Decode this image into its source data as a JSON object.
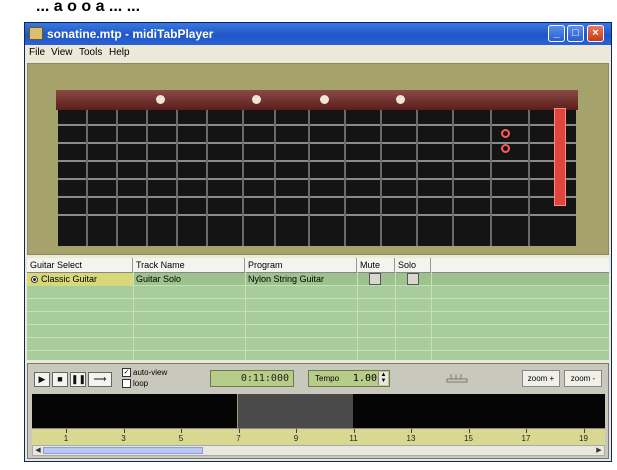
{
  "page_heading": "... a   o     o  a   ...    ...",
  "window": {
    "title": "sonatine.mtp - midiTabPlayer",
    "minimize_glyph": "_",
    "maximize_glyph": "□",
    "close_glyph": "×"
  },
  "menu": [
    "File",
    "View",
    "Tools",
    "Help"
  ],
  "fretboard": {
    "inlay_frets": [
      3,
      5,
      7,
      9
    ],
    "capo_color": "#e0443a"
  },
  "tracks": {
    "headers": [
      "Guitar Select",
      "Track Name",
      "Program",
      "Mute",
      "Solo"
    ],
    "rows": [
      {
        "guitar": "Classic Guitar",
        "name": "Guitar Solo",
        "program": "Nylon String Guitar",
        "selected": true
      }
    ]
  },
  "transport": {
    "buttons": {
      "play": "▶",
      "stop": "■",
      "pause": "❚❚",
      "loop_line": "⟶"
    },
    "auto_view_label": "auto-view",
    "loop_label": "loop",
    "auto_view_checked": true,
    "loop_checked": false,
    "time": "0:11:000",
    "tempo_label": "Tempo",
    "tempo_value": "1.00",
    "zoom_in_label": "zoom +",
    "zoom_out_label": "zoom -",
    "ruler_labels": [
      "1",
      "3",
      "5",
      "7",
      "9",
      "11",
      "13",
      "15",
      "17",
      "19"
    ]
  },
  "colors": {
    "title_bar": "#2a62d4",
    "fret_panel": "#a6a26c",
    "track_panel": "#a8cc9c",
    "timeline": "#050505",
    "ruler": "#d8d890"
  }
}
